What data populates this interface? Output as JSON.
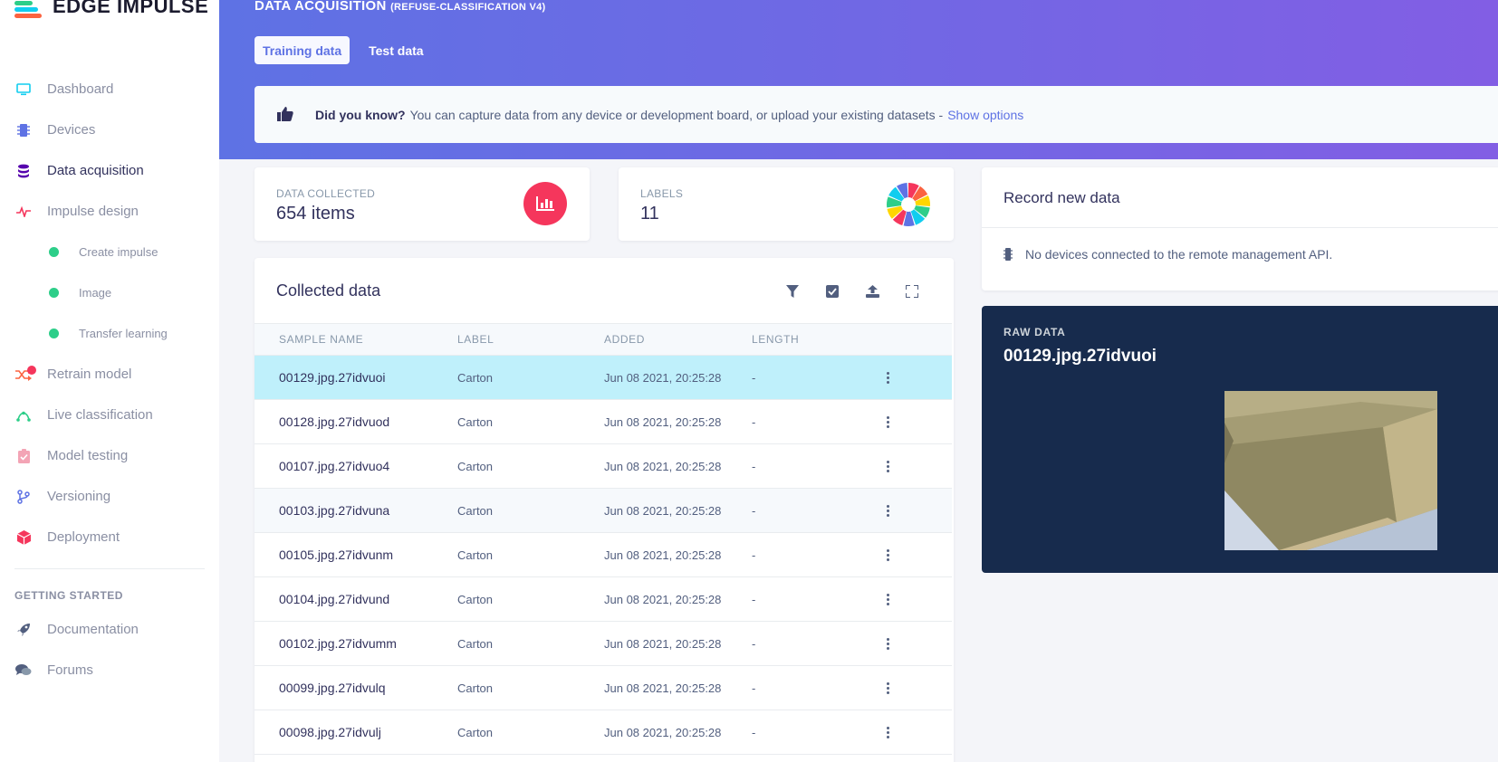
{
  "brand": {
    "name": "EDGE IMPULSE"
  },
  "sidebar": {
    "items": [
      {
        "label": "Dashboard",
        "icon": "monitor-icon",
        "color": "#11cdef"
      },
      {
        "label": "Devices",
        "icon": "chip-icon",
        "color": "#5e72e4"
      },
      {
        "label": "Data acquisition",
        "icon": "database-icon",
        "color": "#5603ad",
        "active": true
      },
      {
        "label": "Impulse design",
        "icon": "pulse-icon",
        "color": "#f5365c"
      }
    ],
    "sub_items": [
      {
        "label": "Create impulse"
      },
      {
        "label": "Image"
      },
      {
        "label": "Transfer learning"
      }
    ],
    "items2": [
      {
        "label": "Retrain model",
        "icon": "shuffle-icon",
        "color": "#fb6340"
      },
      {
        "label": "Live classification",
        "icon": "bezier-icon",
        "color": "#2dce89"
      },
      {
        "label": "Model testing",
        "icon": "clipboard-check-icon",
        "color": "#f3a4b5"
      },
      {
        "label": "Versioning",
        "icon": "branch-icon",
        "color": "#5e72e4"
      },
      {
        "label": "Deployment",
        "icon": "cube-icon",
        "color": "#f5365c"
      }
    ],
    "section_heading": "GETTING STARTED",
    "items3": [
      {
        "label": "Documentation",
        "icon": "rocket-icon",
        "color": "#525f7f"
      },
      {
        "label": "Forums",
        "icon": "chat-icon",
        "color": "#525f7f"
      }
    ]
  },
  "header": {
    "title": "DATA ACQUISITION",
    "project": "(REFUSE-CLASSIFICATION V4)",
    "tabs": [
      {
        "label": "Training data",
        "active": true
      },
      {
        "label": "Test data",
        "active": false
      }
    ]
  },
  "did_you_know": {
    "lead": "Did you know?",
    "text": "You can capture data from any device or development board, or upload your existing datasets -",
    "link": "Show options"
  },
  "stats": {
    "data_collected": {
      "label": "DATA COLLECTED",
      "value": "654 items",
      "icon": "bar-chart-icon",
      "color": "#f5365c"
    },
    "labels": {
      "label": "LABELS",
      "value": "11",
      "icon": "pie-chart-icon"
    }
  },
  "collected": {
    "title": "Collected data",
    "tools": [
      "filter-icon",
      "check-square-icon",
      "upload-icon",
      "fullscreen-icon"
    ],
    "columns": [
      "SAMPLE NAME",
      "LABEL",
      "ADDED",
      "LENGTH"
    ],
    "rows": [
      {
        "name": "00129.jpg.27idvuoi",
        "label": "Carton",
        "added": "Jun 08 2021, 20:25:28",
        "length": "-",
        "state": "selected"
      },
      {
        "name": "00128.jpg.27idvuod",
        "label": "Carton",
        "added": "Jun 08 2021, 20:25:28",
        "length": "-",
        "state": ""
      },
      {
        "name": "00107.jpg.27idvuo4",
        "label": "Carton",
        "added": "Jun 08 2021, 20:25:28",
        "length": "-",
        "state": ""
      },
      {
        "name": "00103.jpg.27idvuna",
        "label": "Carton",
        "added": "Jun 08 2021, 20:25:28",
        "length": "-",
        "state": "hover"
      },
      {
        "name": "00105.jpg.27idvunm",
        "label": "Carton",
        "added": "Jun 08 2021, 20:25:28",
        "length": "-",
        "state": ""
      },
      {
        "name": "00104.jpg.27idvund",
        "label": "Carton",
        "added": "Jun 08 2021, 20:25:28",
        "length": "-",
        "state": ""
      },
      {
        "name": "00102.jpg.27idvumm",
        "label": "Carton",
        "added": "Jun 08 2021, 20:25:28",
        "length": "-",
        "state": ""
      },
      {
        "name": "00099.jpg.27idvulq",
        "label": "Carton",
        "added": "Jun 08 2021, 20:25:28",
        "length": "-",
        "state": ""
      },
      {
        "name": "00098.jpg.27idvulj",
        "label": "Carton",
        "added": "Jun 08 2021, 20:25:28",
        "length": "-",
        "state": ""
      }
    ]
  },
  "record": {
    "title": "Record new data",
    "message": "No devices connected to the remote management API."
  },
  "raw_data": {
    "label": "RAW DATA",
    "sample": "00129.jpg.27idvuoi"
  }
}
